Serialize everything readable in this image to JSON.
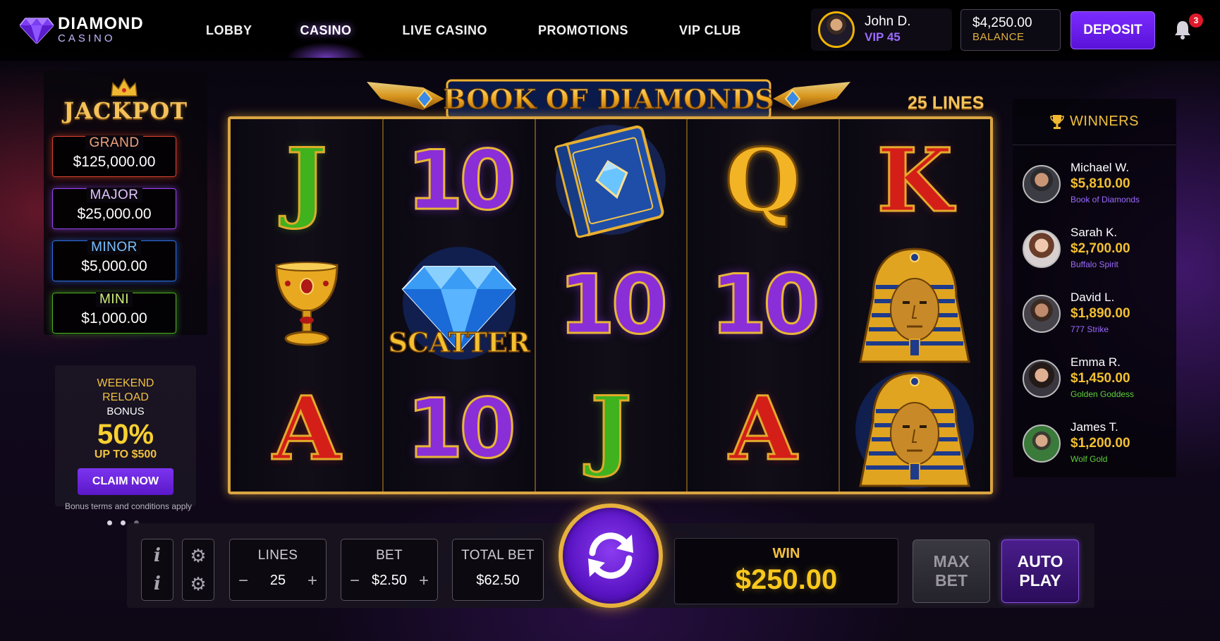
{
  "brand": {
    "name": "DIAMOND",
    "sub": "CASINO"
  },
  "nav": [
    {
      "label": "LOBBY",
      "active": false
    },
    {
      "label": "CASINO",
      "active": true
    },
    {
      "label": "LIVE CASINO",
      "active": false
    },
    {
      "label": "PROMOTIONS",
      "active": false
    },
    {
      "label": "VIP CLUB",
      "active": false
    }
  ],
  "user": {
    "name": "John D.",
    "vip": "VIP 45"
  },
  "balance": {
    "amount": "$4,250.00",
    "label": "BALANCE"
  },
  "deposit_label": "DEPOSIT",
  "notifications": {
    "count": "3"
  },
  "jackpot": {
    "title": "JACKPOT",
    "tiers": [
      {
        "label": "GRAND",
        "value": "$125,000.00",
        "color": "#d4412e"
      },
      {
        "label": "MAJOR",
        "value": "$25,000.00",
        "color": "#9846f0"
      },
      {
        "label": "MINOR",
        "value": "$5,000.00",
        "color": "#2d6fe0"
      },
      {
        "label": "MINI",
        "value": "$1,000.00",
        "color": "#4bb020"
      }
    ]
  },
  "promo": {
    "line1": "WEEKEND",
    "line2": "RELOAD",
    "line3": "BONUS",
    "percent": "50%",
    "up_to": "UP TO $500",
    "cta": "CLAIM NOW",
    "terms": "Bonus terms and conditions apply",
    "slides": 3,
    "active_slide": 2
  },
  "game": {
    "title": "BOOK OF DIAMONDS",
    "lines_label": "25 LINES",
    "reels": [
      [
        "J",
        "goblet",
        "A"
      ],
      [
        "10",
        "diamond-scatter",
        "10"
      ],
      [
        "book",
        "10",
        "J"
      ],
      [
        "Q",
        "10",
        "A"
      ],
      [
        "K",
        "pharaoh",
        "pharaoh"
      ]
    ],
    "scatter_text": "SCATTER"
  },
  "winners": {
    "title": "WINNERS",
    "list": [
      {
        "name": "Michael W.",
        "amount": "$5,810.00",
        "game": "Book of Diamonds",
        "game_color": "#9b6bff"
      },
      {
        "name": "Sarah K.",
        "amount": "$2,700.00",
        "game": "Buffalo Spirit",
        "game_color": "#9b6bff"
      },
      {
        "name": "David L.",
        "amount": "$1,890.00",
        "game": "777 Strike",
        "game_color": "#9b6bff"
      },
      {
        "name": "Emma R.",
        "amount": "$1,450.00",
        "game": "Golden Goddess",
        "game_color": "#5fd03a"
      },
      {
        "name": "James T.",
        "amount": "$1,200.00",
        "game": "Wolf Gold",
        "game_color": "#5fd03a"
      }
    ]
  },
  "controls": {
    "lines": {
      "title": "LINES",
      "value": "25"
    },
    "bet": {
      "title": "BET",
      "value": "$2.50"
    },
    "total_bet": {
      "title": "TOTAL BET",
      "value": "$62.50"
    },
    "win": {
      "title": "WIN",
      "value": "$250.00"
    },
    "max_bet": [
      "MAX",
      "BET"
    ],
    "auto_play": [
      "AUTO",
      "PLAY"
    ]
  }
}
